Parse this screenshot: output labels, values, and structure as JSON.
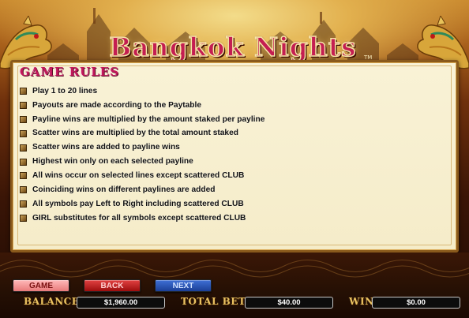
{
  "game": {
    "logo": "Bangkok Nights",
    "trademark": "TM"
  },
  "rules": {
    "title": "GAME RULES",
    "items": [
      "Play 1 to 20 lines",
      "Payouts are made according to the Paytable",
      "Payline wins are multiplied by the amount staked per payline",
      "Scatter wins are multiplied by the total amount staked",
      "Scatter wins are added to payline wins",
      "Highest win only on each selected payline",
      "All wins occur on selected lines except scattered CLUB",
      "Coinciding wins on different paylines are added",
      "All symbols pay Left to Right including scattered CLUB",
      "GIRL substitutes for all symbols except scattered CLUB"
    ]
  },
  "buttons": {
    "game": "GAME",
    "back": "BACK",
    "next": "NEXT"
  },
  "meters": {
    "balance_label": "BALANCE",
    "balance_value": "$1,960.00",
    "totalbet_label": "TOTAL BET",
    "totalbet_value": "$40.00",
    "win_label": "WIN",
    "win_value": "$0.00"
  },
  "colors": {
    "title_pink": "#c2185b",
    "panel_bg": "#f7efd0",
    "label_gold": "#e9c261"
  },
  "icons": [
    "dragon-head-left-icon",
    "dragon-head-right-icon",
    "rule-bullet-icon"
  ]
}
